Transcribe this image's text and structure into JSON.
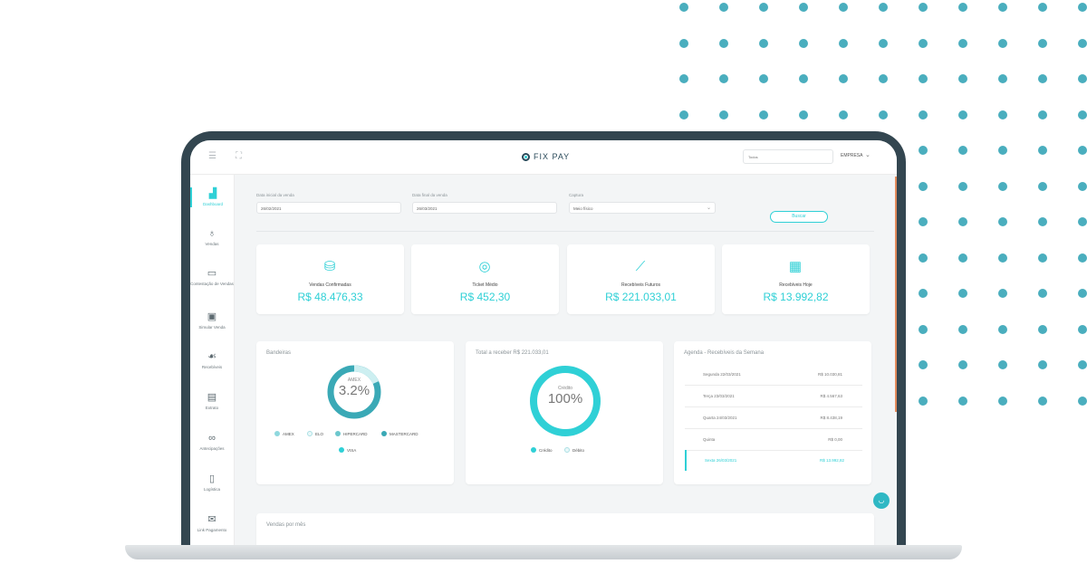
{
  "app": {
    "brand": "FIX PAY",
    "search_placeholder": "Todos",
    "company": "EMPRESA"
  },
  "sidebar": {
    "items": [
      {
        "label": "Dashboard",
        "icon": "bar-chart-icon",
        "active": true
      },
      {
        "label": "Vendas",
        "icon": "money-bag-icon"
      },
      {
        "label": "Contestação de Vendas",
        "icon": "card-icon"
      },
      {
        "label": "Simular Venda",
        "icon": "calculator-icon"
      },
      {
        "label": "Recebíveis",
        "icon": "hand-coin-icon"
      },
      {
        "label": "Extrato",
        "icon": "clipboard-icon"
      },
      {
        "label": "Antecipações",
        "icon": "handshake-icon"
      },
      {
        "label": "Logística",
        "icon": "clipboard-list-icon"
      },
      {
        "label": "Link Pagamento",
        "icon": "envelope-icon"
      }
    ]
  },
  "filters": {
    "start_label": "Data inicial da venda",
    "start_value": "26/02/2021",
    "end_label": "Data final da venda",
    "end_value": "26/03/2021",
    "capture_label": "Captura",
    "capture_value": "Meio físico",
    "search_button": "Buscar"
  },
  "kpis": [
    {
      "label": "Vendas Confirmadas",
      "value": "R$ 48.476,33",
      "icon": "coins-icon"
    },
    {
      "label": "Ticket Médio",
      "value": "R$ 452,30",
      "icon": "coin-icon"
    },
    {
      "label": "Recebíveis Futuros",
      "value": "R$ 221.033,01",
      "icon": "growth-chart-icon"
    },
    {
      "label": "Recebíveis Hoje",
      "value": "R$ 13.992,82",
      "icon": "calendar-icon"
    }
  ],
  "bandeiras": {
    "title": "Bandeiras",
    "center_label": "AMEX",
    "center_value": "3.2%",
    "legend": [
      "AMEX",
      "ELO",
      "HIPERCARD",
      "MASTERCARD",
      "VISA"
    ],
    "colors": [
      "#8fd8de",
      "#cdeff1",
      "#6cc7cd",
      "#3aa9b6",
      "#2fd0d6"
    ]
  },
  "total": {
    "title": "Total a receber R$ 221.033,01",
    "center_label": "Crédito",
    "center_value": "100%",
    "legend": [
      "Crédito",
      "Débito"
    ]
  },
  "agenda": {
    "title": "Agenda - Recebíveis da Semana",
    "rows": [
      {
        "day": "Segunda 22/03/2021",
        "value": "R$ 10.030,81"
      },
      {
        "day": "Terça 23/03/2021",
        "value": "R$ 4.567,63"
      },
      {
        "day": "Quarta 24/03/2021",
        "value": "R$ 8.438,19"
      },
      {
        "day": "Quinta",
        "value": "R$ 0,00"
      },
      {
        "day": "Sexta 26/03/2021",
        "value": "R$ 13.992,82"
      }
    ]
  },
  "monthly": {
    "title": "Vendas por mês"
  },
  "colors": {
    "accent": "#2fd0d6",
    "frame": "#334650",
    "dots": "#4aaebe"
  }
}
